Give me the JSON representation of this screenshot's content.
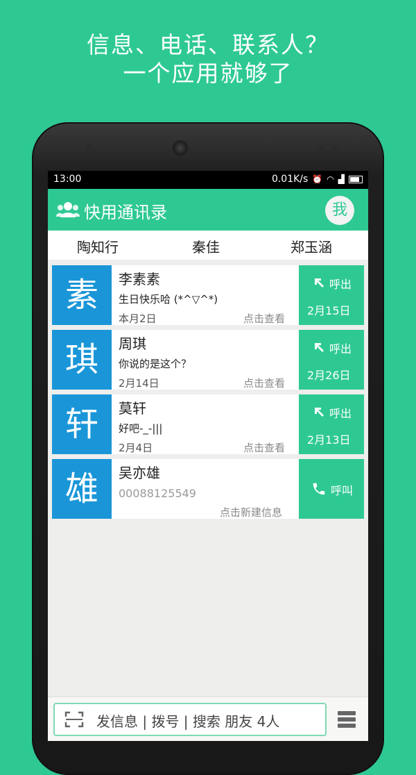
{
  "promo": {
    "line1": "信息、电话、联系人？",
    "line2": "一个应用就够了"
  },
  "status": {
    "time": "13:00",
    "speed": "0.01K/s"
  },
  "appbar": {
    "title": "快用通讯录",
    "me_label": "我"
  },
  "favorites": [
    "陶知行",
    "秦佳",
    "郑玉涵"
  ],
  "cards": [
    {
      "avatar": "素",
      "name": "李素素",
      "message": "生日快乐哈 (*^▽^*)",
      "date": "本月2日",
      "view": "点击查看",
      "action_label": "呼出",
      "action_date": "2月15日"
    },
    {
      "avatar": "琪",
      "name": "周琪",
      "message": "你说的是这个？",
      "date": "2月14日",
      "view": "点击查看",
      "action_label": "呼出",
      "action_date": "2月26日"
    },
    {
      "avatar": "轩",
      "name": "莫轩",
      "message": "好吧-_-|||",
      "date": "2月4日",
      "view": "点击查看",
      "action_label": "呼出",
      "action_date": "2月13日"
    },
    {
      "avatar": "雄",
      "name": "吴亦雄",
      "phone": "00088125549",
      "new_message": "点击新建信息",
      "action_label": "呼叫"
    }
  ],
  "bottombar": {
    "search_text": "发信息 | 拨号 | 搜索 朋友 4人"
  },
  "colors": {
    "green": "#2ec993",
    "blue": "#1a96d8"
  },
  "icons": [
    "users-icon",
    "outgoing-call-arrow-icon",
    "phone-icon",
    "scan-icon",
    "menu-icon",
    "wifi-icon",
    "alarm-icon",
    "battery-icon"
  ]
}
